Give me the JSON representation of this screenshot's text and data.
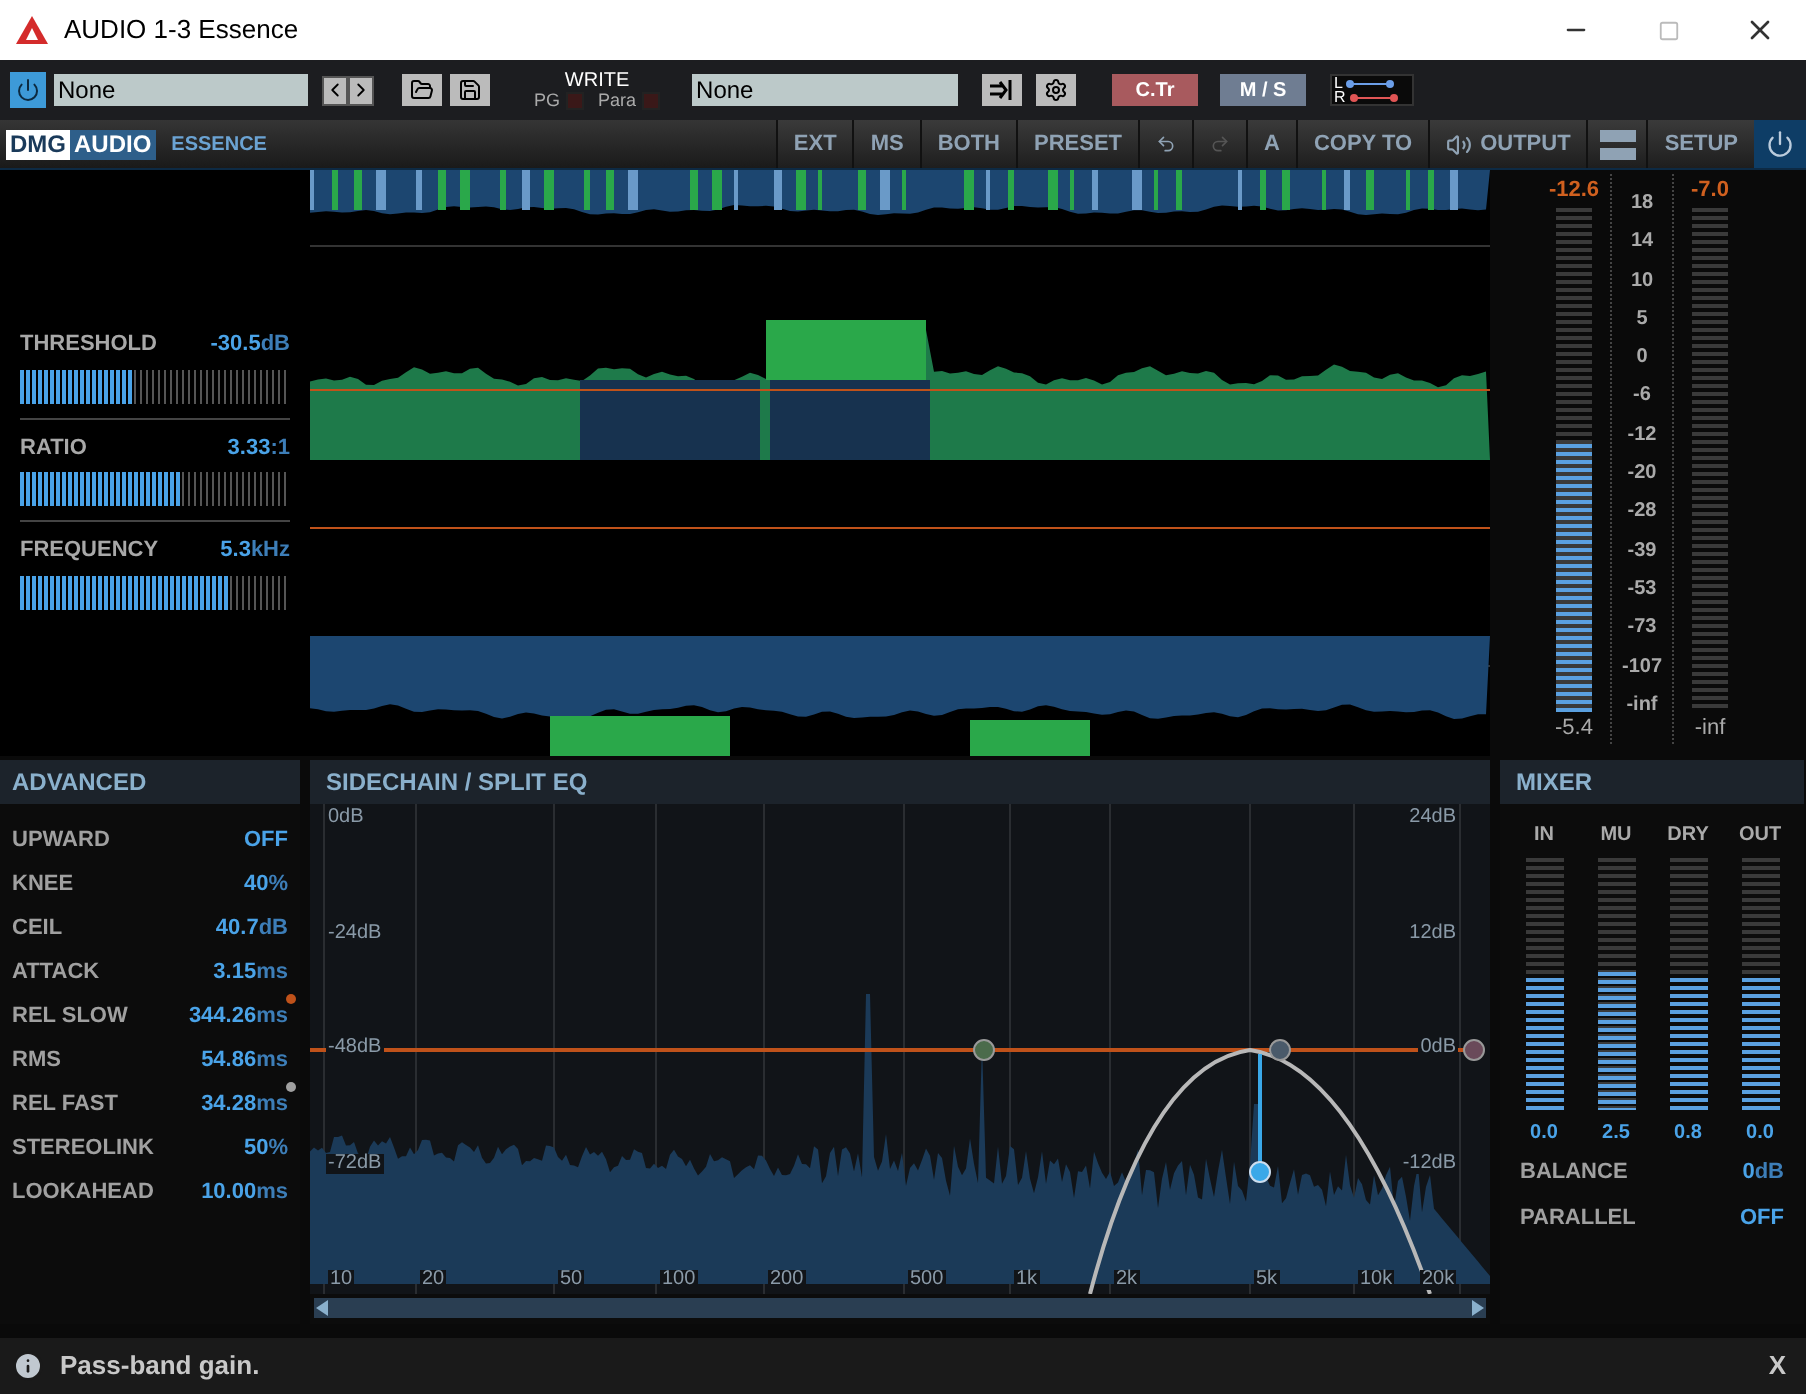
{
  "window": {
    "title": "AUDIO 1-3 Essence"
  },
  "host_bar": {
    "power_on": true,
    "preset": "None",
    "write_label": "WRITE",
    "write_pg": "PG",
    "pg_checked": false,
    "write_para": "Para",
    "para_checked": false,
    "automation": "None",
    "ctr": "C.Tr",
    "ms": "M / S",
    "lr_l": "L",
    "lr_r": "R"
  },
  "header": {
    "brand_a": "DMG",
    "brand_b": "AUDIO",
    "product": "ESSENCE",
    "buttons": [
      {
        "kind": "text",
        "label": "EXT"
      },
      {
        "kind": "text",
        "label": "MS"
      },
      {
        "kind": "text",
        "label": "BOTH"
      },
      {
        "kind": "text",
        "label": "PRESET"
      },
      {
        "kind": "undo"
      },
      {
        "kind": "redo"
      },
      {
        "kind": "text",
        "label": "A"
      },
      {
        "kind": "text",
        "label": "COPY TO"
      },
      {
        "kind": "output",
        "label": "OUTPUT"
      },
      {
        "kind": "bars"
      },
      {
        "kind": "text",
        "label": "SETUP"
      },
      {
        "kind": "power",
        "on": true
      }
    ]
  },
  "controls": [
    {
      "label": "THRESHOLD",
      "value": "-30.5",
      "unit": "dB",
      "level": 0.42
    },
    {
      "label": "RATIO",
      "value": "3.33",
      "unit": ":1",
      "level": 0.6
    },
    {
      "label": "FREQUENCY",
      "value": "5.3",
      "unit": "kHz",
      "level": 0.79
    }
  ],
  "meters": {
    "input": {
      "peak": "-12.6",
      "reading": "-5.4",
      "level": 0.53
    },
    "output": {
      "peak": "-7.0",
      "reading": "-inf"
    },
    "scale": [
      "18",
      "14",
      "10",
      "5",
      "0",
      "-6",
      "-12",
      "-20",
      "-28",
      "-39",
      "-53",
      "-73",
      "-107",
      "-inf"
    ]
  },
  "advanced": {
    "title": "ADVANCED",
    "rows": [
      {
        "label": "UPWARD",
        "value": "OFF"
      },
      {
        "label": "KNEE",
        "value": "40",
        "unit": "%"
      },
      {
        "label": "CEIL",
        "value": "40.7",
        "unit": "dB"
      },
      {
        "label": "ATTACK",
        "value": "3.15",
        "unit": "ms"
      },
      {
        "label": "REL SLOW",
        "value": "344.26",
        "unit": "ms",
        "color": "#c0521a"
      },
      {
        "label": "RMS",
        "value": "54.86",
        "unit": "ms"
      },
      {
        "label": "REL FAST",
        "value": "34.28",
        "unit": "ms",
        "color": "#a0a0a0"
      },
      {
        "label": "STEREOLINK",
        "value": "50",
        "unit": "%"
      },
      {
        "label": "LOOKAHEAD",
        "value": "10.00",
        "unit": "ms"
      }
    ]
  },
  "eq": {
    "title": "SIDECHAIN / SPLIT EQ",
    "left_ticks": [
      "0dB",
      "-24dB",
      "-48dB",
      "-72dB"
    ],
    "right_ticks": [
      "24dB",
      "12dB",
      "0dB",
      "-12dB"
    ],
    "freq_ticks": [
      "10",
      "20",
      "50",
      "100",
      "200",
      "500",
      "1k",
      "2k",
      "5k",
      "10k",
      "20k"
    ]
  },
  "mixer": {
    "title": "MIXER",
    "faders": [
      {
        "label": "IN",
        "reading": "0.0",
        "level": 0.52
      },
      {
        "label": "MU",
        "reading": "2.5",
        "level": 0.55
      },
      {
        "label": "DRY",
        "reading": "0.8",
        "level": 0.52
      },
      {
        "label": "OUT",
        "reading": "0.0",
        "level": 0.52
      }
    ],
    "balance": {
      "label": "BALANCE",
      "value": "0",
      "unit": "dB"
    },
    "parallel": {
      "label": "PARALLEL",
      "value": "OFF"
    }
  },
  "status": {
    "message": "Pass-band gain.",
    "close": "X"
  }
}
